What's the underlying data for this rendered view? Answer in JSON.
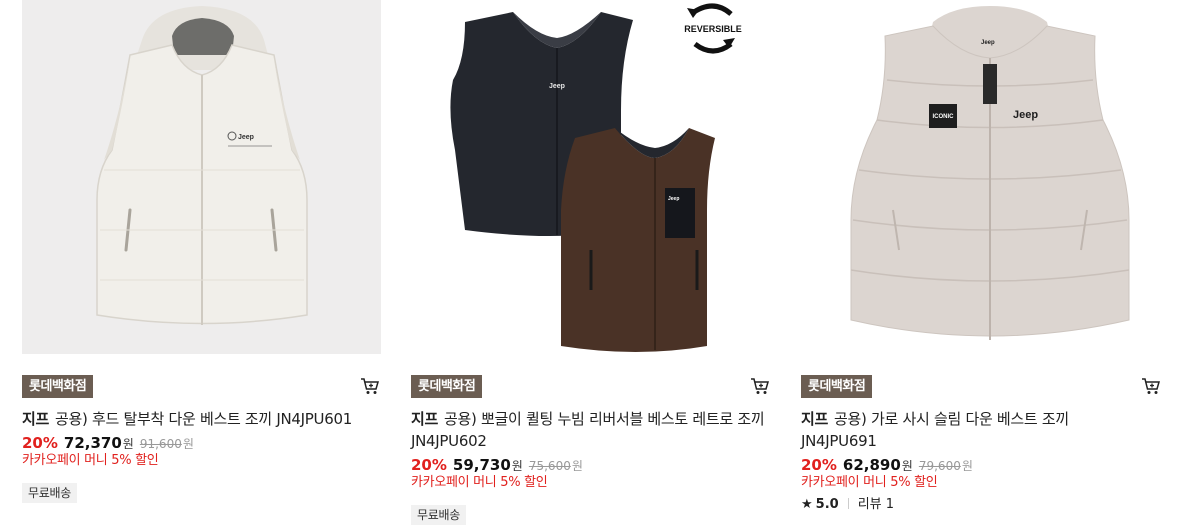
{
  "products": [
    {
      "store": "롯데백화점",
      "brand": "지프",
      "name": "공용) 후드 탈부착 다운 베스트 조끼 JN4JPU601",
      "discount": "20%",
      "price": "72,370",
      "currency": "원",
      "original_price": "91,600",
      "promo": "카카오페이 머니 5% 할인",
      "tag": "무료배송"
    },
    {
      "store": "롯데백화점",
      "brand": "지프",
      "name": "공용) 뽀글이 퀼팅 누빔 리버서블 베스토 레트로 조끼 JN4JPU602",
      "discount": "20%",
      "price": "59,730",
      "currency": "원",
      "original_price": "75,600",
      "promo": "카카오페이 머니 5% 할인",
      "tag": "무료배송",
      "image_badge": "REVERSIBLE"
    },
    {
      "store": "롯데백화점",
      "brand": "지프",
      "name": "공용) 가로 사시 슬림 다운 베스트 조끼 JN4JPU691",
      "discount": "20%",
      "price": "62,890",
      "currency": "원",
      "original_price": "79,600",
      "promo": "카카오페이 머니 5% 할인",
      "rating": "5.0",
      "review_label": "리뷰 1"
    }
  ],
  "image_logos": {
    "jeep": "Jeep",
    "iconic": "ICONIC"
  },
  "icons": {
    "cart": "cart-icon",
    "star": "star-icon"
  },
  "colors": {
    "discount": "#e1211e",
    "store_badge": "#6b5d52",
    "tag_bg": "#f1f1f1"
  }
}
